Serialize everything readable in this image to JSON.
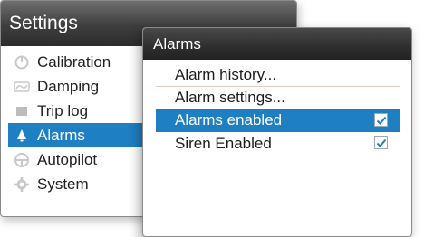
{
  "settings": {
    "title": "Settings",
    "items": [
      {
        "label": "Calibration",
        "icon": "calibration-icon"
      },
      {
        "label": "Damping",
        "icon": "damping-icon"
      },
      {
        "label": "Trip log",
        "icon": "trip-log-icon"
      },
      {
        "label": "Alarms",
        "icon": "bell-icon",
        "selected": true
      },
      {
        "label": "Autopilot",
        "icon": "autopilot-icon"
      },
      {
        "label": "System",
        "icon": "system-gear-icon"
      }
    ]
  },
  "alarms": {
    "title": "Alarms",
    "items": [
      {
        "label": "Alarm history..."
      },
      {
        "label": "Alarm settings..."
      },
      {
        "label": "Alarms enabled",
        "checked": true,
        "selected": true
      },
      {
        "label": "Siren Enabled",
        "checked": true
      }
    ]
  },
  "colors": {
    "selection": "#1e7fc3",
    "titlebar": "#2e2e2e",
    "checkmark": "#1e7fc3"
  }
}
